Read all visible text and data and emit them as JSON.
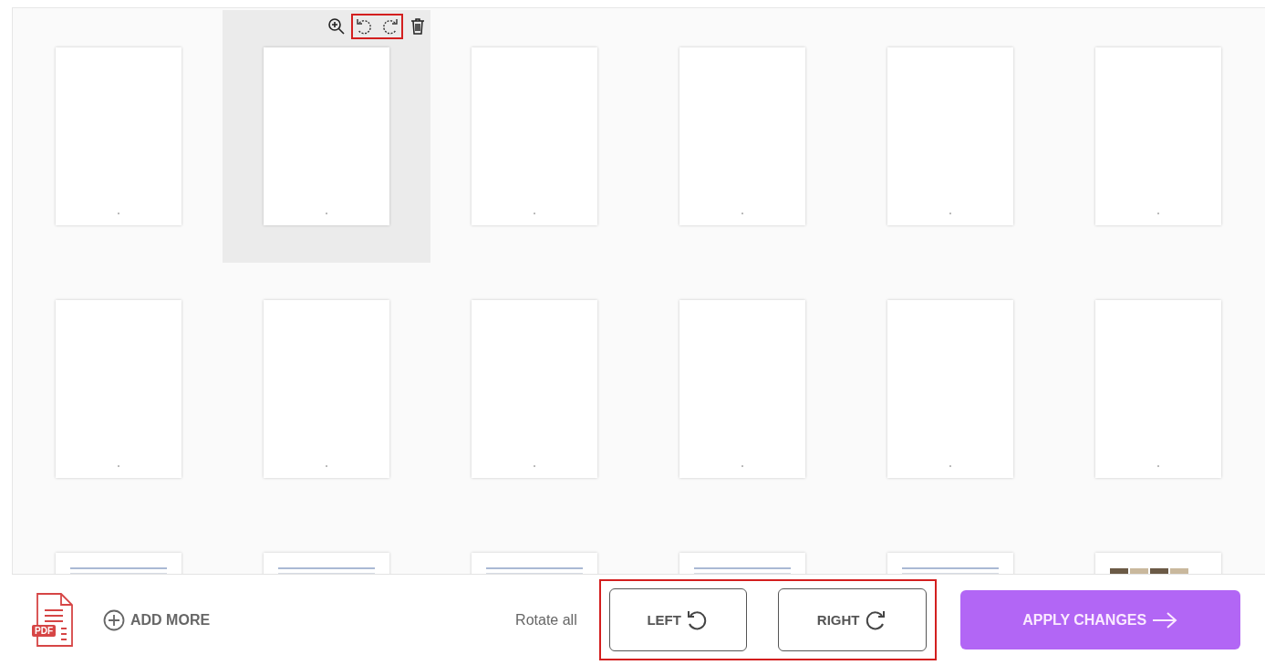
{
  "page_tools": {
    "rotate_highlighted": true
  },
  "pages": [
    {
      "kind": "blank",
      "selected": false
    },
    {
      "kind": "blank",
      "selected": true
    },
    {
      "kind": "blank",
      "selected": false
    },
    {
      "kind": "blank",
      "selected": false
    },
    {
      "kind": "blank",
      "selected": false
    },
    {
      "kind": "blank",
      "selected": false
    },
    {
      "kind": "blank",
      "selected": false
    },
    {
      "kind": "blank",
      "selected": false
    },
    {
      "kind": "blank",
      "selected": false
    },
    {
      "kind": "blank",
      "selected": false
    },
    {
      "kind": "blank",
      "selected": false
    },
    {
      "kind": "blank",
      "selected": false
    },
    {
      "kind": "document",
      "selected": false
    },
    {
      "kind": "document",
      "selected": false
    },
    {
      "kind": "document",
      "selected": false
    },
    {
      "kind": "document",
      "selected": false
    },
    {
      "kind": "document",
      "selected": false
    },
    {
      "kind": "photo",
      "selected": false
    }
  ],
  "footer": {
    "file_badge": "PDF",
    "add_more": "ADD MORE",
    "rotate_label": "Rotate all",
    "rotate_highlighted": true,
    "rotate_buttons": [
      {
        "label": "LEFT",
        "kind": "ccw"
      },
      {
        "label": "RIGHT",
        "kind": "cw"
      }
    ],
    "apply": "APPLY CHANGES"
  }
}
